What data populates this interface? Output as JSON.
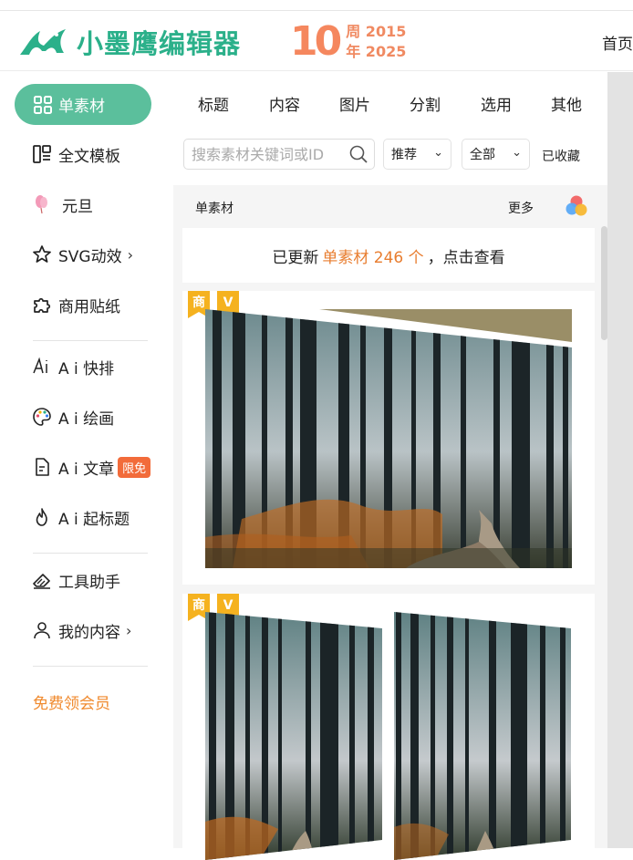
{
  "header": {
    "logo_text": "小墨鹰编辑器",
    "anniversary": {
      "number": "10",
      "line1": "周 2015",
      "line2": "年 2025"
    },
    "home_link": "首页"
  },
  "sidebar": {
    "active": {
      "label": "单素材",
      "icon": "grid-icon"
    },
    "items": [
      {
        "label": "全文模板",
        "icon": "template-icon"
      },
      {
        "label": "元旦",
        "icon": "balloon-icon"
      },
      {
        "label": "SVG动效",
        "icon": "star-icon",
        "arrow": "›"
      },
      {
        "label": "商用贴纸",
        "icon": "puzzle-icon"
      },
      {
        "label": "A i 快排",
        "icon": "ai-icon"
      },
      {
        "label": "A i 绘画",
        "icon": "palette-icon"
      },
      {
        "label": "A i 文章",
        "icon": "document-icon",
        "badge": "限免"
      },
      {
        "label": "A i 起标题",
        "icon": "fire-icon"
      },
      {
        "label": "工具助手",
        "icon": "eraser-icon"
      },
      {
        "label": "我的内容",
        "icon": "user-icon",
        "arrow": "›"
      }
    ],
    "vip_link": "免费领会员"
  },
  "tabs": [
    "标题",
    "内容",
    "图片",
    "分割",
    "选用",
    "其他"
  ],
  "filters": {
    "search_placeholder": "搜索素材关键词或ID",
    "sort": "推荐",
    "scope": "全部",
    "collected": "已收藏"
  },
  "section": {
    "title": "单素材",
    "more": "更多"
  },
  "notice": {
    "prefix": "已更新",
    "highlight": "单素材 246 个",
    "suffix": "，点击查看"
  },
  "cards": [
    {
      "tags": [
        "商",
        "V"
      ]
    },
    {
      "tags": [
        "商",
        "V"
      ]
    }
  ],
  "colors": {
    "brand": "#2bb08a",
    "active_bg": "#5bbf9c",
    "highlight": "#e87d2f",
    "badge": "#f26b3a",
    "tag": "#f5b21f"
  }
}
